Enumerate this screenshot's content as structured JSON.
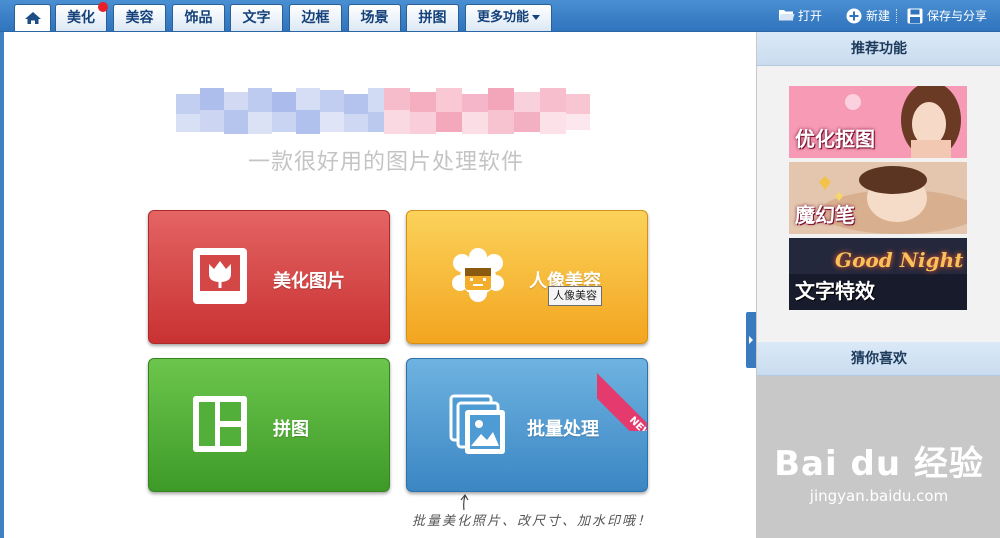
{
  "toolbar": {
    "tabs": [
      "美化",
      "美容",
      "饰品",
      "文字",
      "边框",
      "场景",
      "拼图",
      "更多功能"
    ],
    "open_label": "打开",
    "new_label": "新建",
    "save_label": "保存与分享"
  },
  "main": {
    "tagline": "一款很好用的图片处理软件",
    "cards": [
      {
        "label": "美化图片",
        "icon": "flower-picture-icon"
      },
      {
        "label": "人像美容",
        "icon": "face-icon"
      },
      {
        "label": "拼图",
        "icon": "collage-icon"
      },
      {
        "label": "批量处理",
        "icon": "photo-stack-icon"
      }
    ],
    "new_badge": "NEW",
    "tooltip": "人像美容",
    "batch_hint": "批量美化照片、改尺寸、加水印哦！"
  },
  "side": {
    "recommend_title": "推荐功能",
    "banners": [
      "优化抠图",
      "魔幻笔",
      "文字特效"
    ],
    "banner3_script": "Good Night",
    "guess_title": "猜你喜欢"
  },
  "watermark": {
    "logo": "Bai du 经验",
    "url": "jingyan.baidu.com"
  },
  "colors": {
    "toolbar_blue": "#3a7ec6",
    "card_red": "#d44747",
    "card_yellow": "#f7bd3a",
    "card_green": "#52b03a",
    "card_blue": "#4f9bd3",
    "badge_pink": "#e43a6e"
  }
}
